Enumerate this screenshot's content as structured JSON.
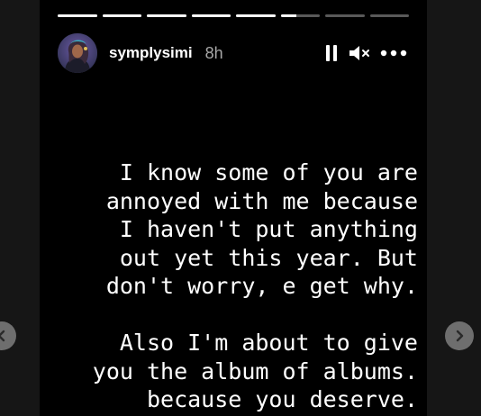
{
  "story": {
    "username": "symplysimi",
    "time": "8h",
    "progress": [
      1,
      1,
      1,
      1,
      1,
      0.4,
      0,
      0
    ],
    "text_lines": [
      "I know some of you are",
      "annoyed with me because",
      "I haven't put anything",
      "out yet this year. But",
      "don't worry, e get why.",
      "",
      "Also I'm about to give",
      "you the album of albums.",
      "because you deserve."
    ]
  },
  "icons": {
    "avatar": "profile-avatar",
    "pause": "pause-icon",
    "mute": "muted-speaker-icon",
    "more": "more-options-icon",
    "prev": "chevron-left-icon",
    "next": "chevron-right-icon"
  },
  "colors": {
    "story_bg": "#000000",
    "page_bg": "#161616",
    "text": "#ffffff",
    "time": "#a8a8a8",
    "nav_button": "#6e6e6e"
  }
}
